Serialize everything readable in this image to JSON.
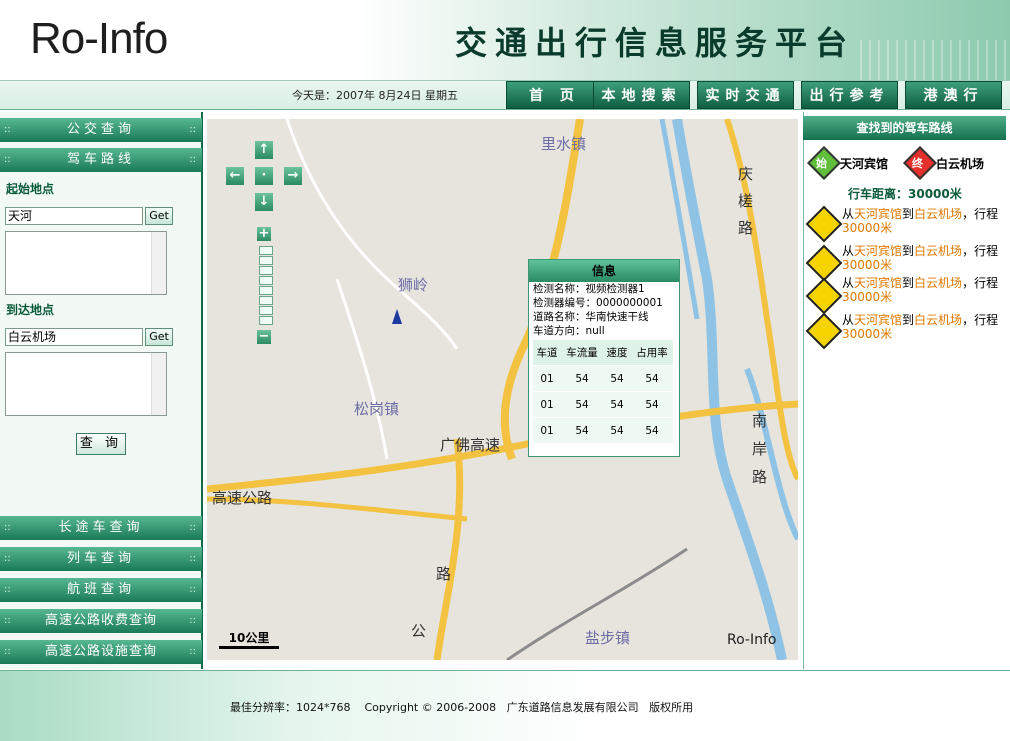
{
  "header": {
    "logo": "Ro-Info",
    "title": "交通出行信息服务平台"
  },
  "nav": {
    "date": "今天是：2007年 8月24日 星期五",
    "tabs": [
      "首 页",
      "本地搜索",
      "实时交通",
      "出行参考",
      "港澳行"
    ]
  },
  "left": {
    "bars_top": [
      "公交查询",
      "驾车路线"
    ],
    "start_label": "起始地点",
    "start_value": "天河",
    "end_label": "到达地点",
    "end_value": "白云机场",
    "get_label": "Get",
    "query_label": "查 询",
    "bars_bottom": [
      "长途车查询",
      "列车查询",
      "航班查询",
      "高速公路收费查询",
      "高速公路设施查询"
    ]
  },
  "map": {
    "scale": "10公里",
    "logo": "Ro-Info",
    "labels": [
      "里水镇",
      "庆",
      "槎",
      "路",
      "狮岭",
      "松岗镇",
      "广佛高速",
      "高速公路",
      "路",
      "公",
      "盐步镇",
      "南",
      "岸",
      "路"
    ],
    "controls": [
      "↑",
      "←",
      "·",
      "→",
      "↓",
      "+",
      "−"
    ]
  },
  "info": {
    "title": "信息",
    "lines": [
      "检测名称：视频检测器1",
      "检测器编号：0000000001",
      "道路名称：华南快速干线",
      "车道方向：null"
    ],
    "columns": [
      "车道",
      "车流量",
      "速度",
      "占用率"
    ],
    "rows": [
      [
        "01",
        "54",
        "54",
        "54"
      ],
      [
        "01",
        "54",
        "54",
        "54"
      ],
      [
        "01",
        "54",
        "54",
        "54"
      ]
    ]
  },
  "right": {
    "header": "查找到的驾车路线",
    "start_badge": "始",
    "start_name": "天河宾馆",
    "end_badge": "终",
    "end_name": "白云机场",
    "distance": "行车距离：30000米",
    "routes": [
      {
        "from": "从",
        "a": "天河宾馆",
        "to": "到",
        "b": "白云机场",
        "mid": "，行程",
        "dist": "30000米"
      },
      {
        "from": "从",
        "a": "天河宾馆",
        "to": "到",
        "b": "白云机场",
        "mid": "，行程",
        "dist": "30000米"
      },
      {
        "from": "从",
        "a": "天河宾馆",
        "to": "到",
        "b": "白云机场",
        "mid": "，行程",
        "dist": "30000米"
      },
      {
        "from": "从",
        "a": "天河宾馆",
        "to": "到",
        "b": "白云机场",
        "mid": "，行程",
        "dist": "30000米"
      }
    ]
  },
  "footer": {
    "text": "最佳分辨率：1024*768    Copyright © 2006-2008   广东道路信息发展有限公司   版权所用"
  },
  "colors": {
    "brand": "#0f6a48",
    "accent": "#3e9f7a",
    "road": "#f2c240",
    "river": "#8ec3e6",
    "orange": "#e07800"
  }
}
